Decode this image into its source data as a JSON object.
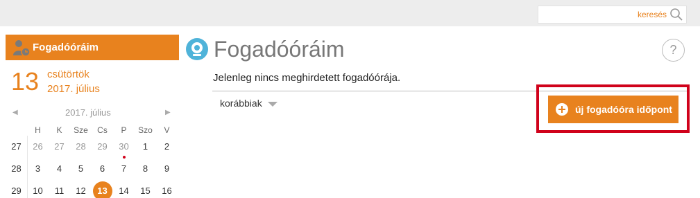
{
  "search": {
    "label": "keresés"
  },
  "sidebar": {
    "title": "Fogadóóráim",
    "date_day_num": "13",
    "date_weekday": "csütörtök",
    "date_month": "2017. július",
    "calendar": {
      "title": "2017. július",
      "headers": [
        "H",
        "K",
        "Sze",
        "Cs",
        "P",
        "Szo",
        "V"
      ],
      "weeks": [
        [
          "27",
          "26",
          "27",
          "28",
          "29",
          "30",
          "1",
          "2"
        ],
        [
          "28",
          "3",
          "4",
          "5",
          "6",
          "7",
          "8",
          "9"
        ],
        [
          "29",
          "10",
          "11",
          "12",
          "13",
          "14",
          "15",
          "16"
        ]
      ]
    }
  },
  "main": {
    "title": "Fogadóóráim",
    "help": "?",
    "notice": "Jelenleg nincs meghirdetett fogadóórája.",
    "previous_label": "korábbiak",
    "new_button": "új fogadóóra időpont"
  },
  "colors": {
    "accent": "#e8821e",
    "highlight": "#d0021b"
  }
}
